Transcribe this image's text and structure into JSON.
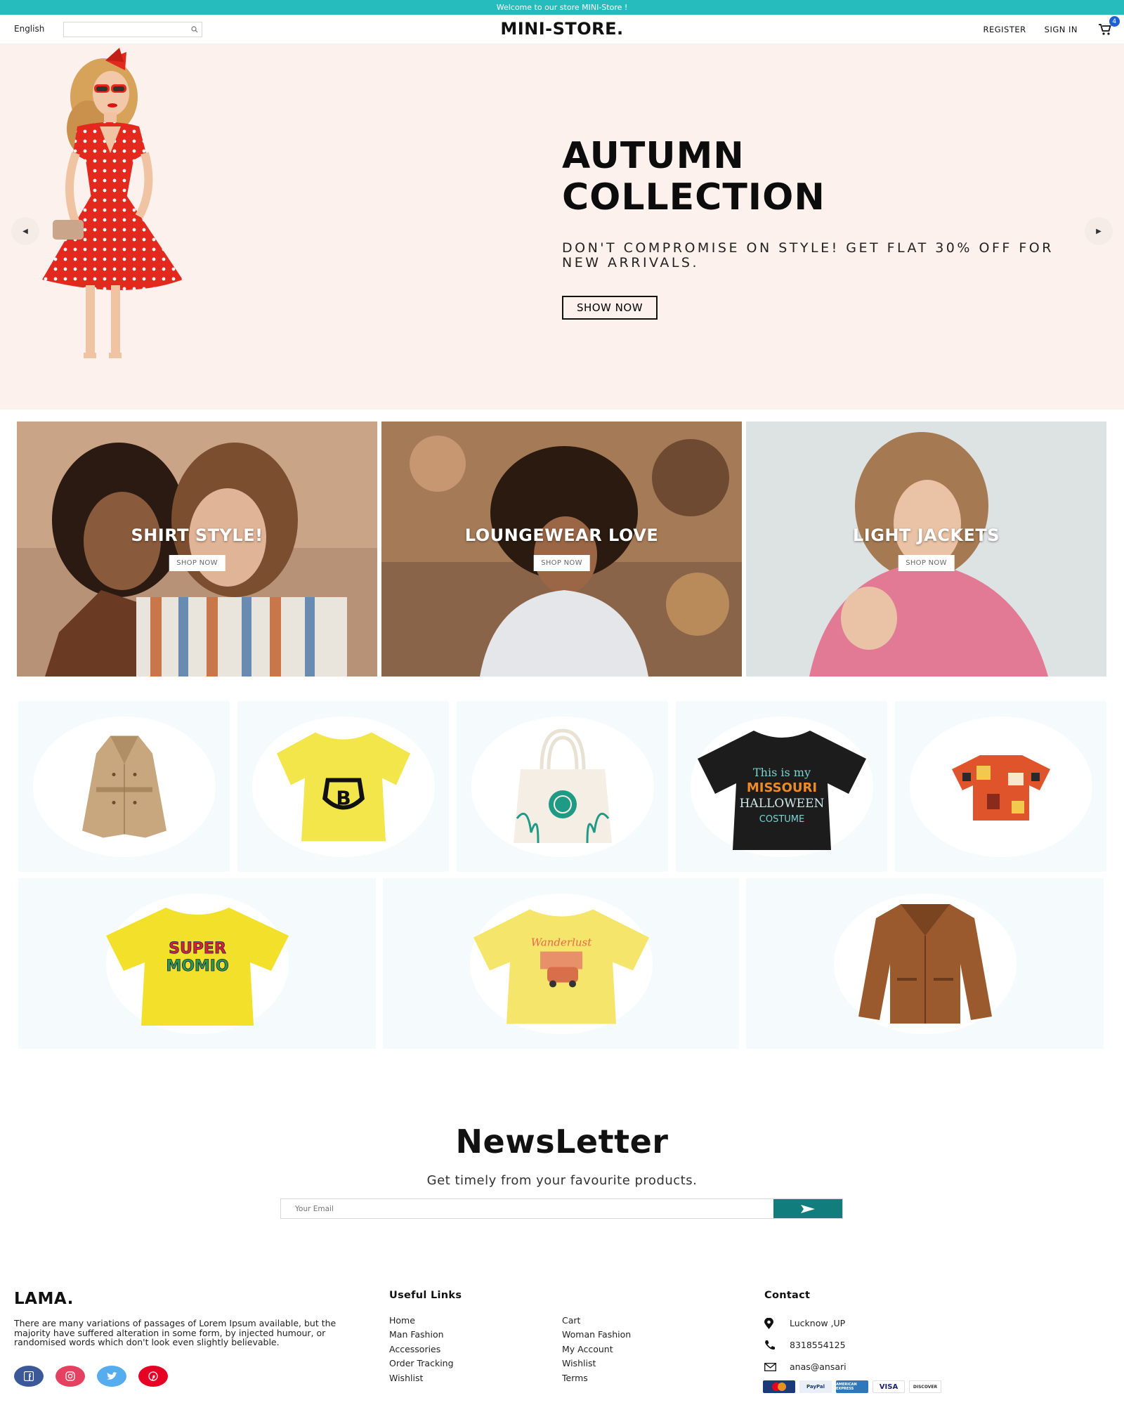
{
  "announcement": "Welcome to our store MINI-Store !",
  "nav": {
    "language": "English",
    "search_placeholder": "",
    "logo": "MINI-STORE.",
    "register": "REGISTER",
    "sign_in": "SIGN IN",
    "cart_count": "4"
  },
  "hero": {
    "title_line1": "AUTUMN",
    "title_line2": "COLLECTION",
    "description": "DON'T COMPROMISE ON STYLE! GET FLAT 30% OFF FOR NEW ARRIVALS.",
    "button": "SHOW NOW"
  },
  "categories": [
    {
      "title": "SHIRT STYLE!",
      "button": "SHOP NOW"
    },
    {
      "title": "LOUNGEWEAR LOVE",
      "button": "SHOP NOW"
    },
    {
      "title": "LIGHT JACKETS",
      "button": "SHOP NOW"
    }
  ],
  "products": [
    {
      "icon": "trench-coat"
    },
    {
      "icon": "yellow-tshirt-b"
    },
    {
      "icon": "tote-bag"
    },
    {
      "icon": "black-tshirt"
    },
    {
      "icon": "hawaiian-shirt"
    },
    {
      "icon": "yellow-tshirt-super"
    },
    {
      "icon": "yellow-tshirt-wanderlust"
    },
    {
      "icon": "leather-jacket"
    }
  ],
  "newsletter": {
    "title": "NewsLetter",
    "description": "Get timely from your favourite products.",
    "placeholder": "Your Email"
  },
  "footer": {
    "logo": "LAMA.",
    "description": "There are many variations of passages of Lorem Ipsum available, but the majority have suffered alteration in some form, by injected humour, or randomised words which don't look even slightly believable.",
    "useful_links_title": "Useful Links",
    "links_col1": [
      "Home",
      "Man Fashion",
      "Accessories",
      "Order Tracking",
      "Wishlist"
    ],
    "links_col2": [
      "Cart",
      "Woman Fashion",
      "My Account",
      "Wishlist",
      "Terms"
    ],
    "contact_title": "Contact",
    "address": "Lucknow ,UP",
    "phone": "8318554125",
    "email": "anas@ansari",
    "payment_cards": [
      "MasterCard",
      "PayPal",
      "AMERICAN EXPRESS",
      "VISA",
      "DISCOVER"
    ]
  },
  "colors": {
    "accent": "#26bcbd",
    "hero_bg": "#fcf1ed",
    "product_bg": "#f5fbfd",
    "newsletter_button": "#117d7d",
    "badge": "#1f5fd6"
  }
}
